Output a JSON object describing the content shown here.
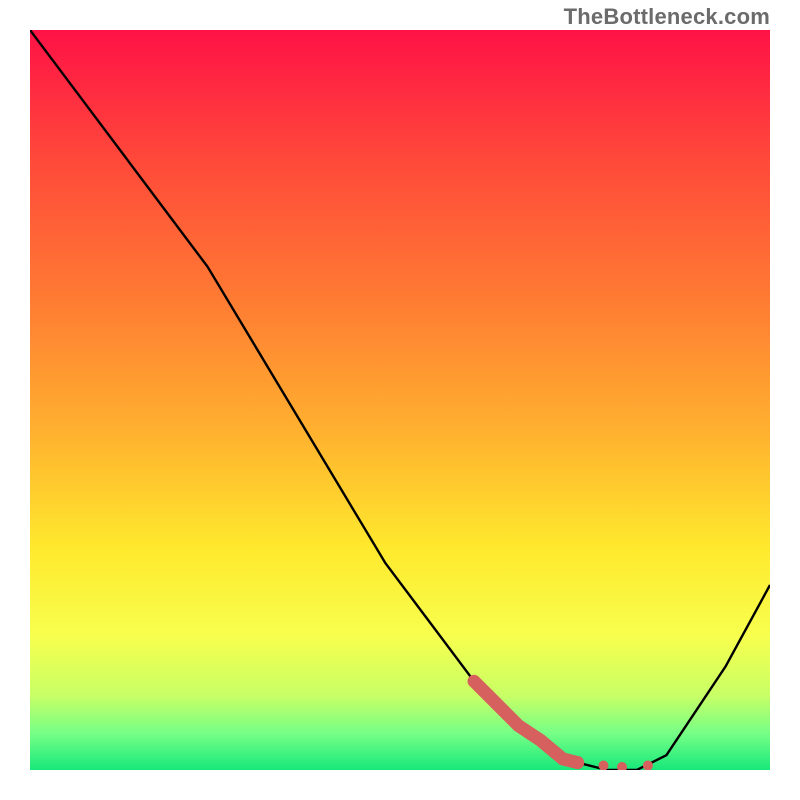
{
  "watermark": "TheBottleneck.com",
  "chart_data": {
    "type": "line",
    "title": "",
    "xlabel": "",
    "ylabel": "",
    "xlim": [
      0,
      100
    ],
    "ylim": [
      0,
      100
    ],
    "curve": {
      "x": [
        0,
        6,
        12,
        18,
        24,
        30,
        36,
        42,
        48,
        54,
        60,
        66,
        70,
        74,
        78,
        82,
        86,
        90,
        94,
        100
      ],
      "y": [
        100,
        92,
        84,
        76,
        68,
        58,
        48,
        38,
        28,
        20,
        12,
        6,
        3,
        1,
        0,
        0,
        2,
        8,
        14,
        25
      ]
    },
    "highlight_segment": {
      "x": [
        60,
        63,
        66,
        69,
        72,
        74
      ],
      "y": [
        12,
        9,
        6,
        4,
        1.5,
        1
      ]
    },
    "highlight_dots": {
      "x": [
        74,
        77.5,
        80,
        83.5
      ],
      "y": [
        1,
        0.6,
        0.4,
        0.6
      ]
    },
    "gradient_stops": [
      {
        "offset": 0.0,
        "color": "#ff1246"
      },
      {
        "offset": 0.18,
        "color": "#ff4a3a"
      },
      {
        "offset": 0.36,
        "color": "#ff7a33"
      },
      {
        "offset": 0.54,
        "color": "#ffb02f"
      },
      {
        "offset": 0.7,
        "color": "#ffe92d"
      },
      {
        "offset": 0.82,
        "color": "#f7ff4e"
      },
      {
        "offset": 0.9,
        "color": "#c7ff66"
      },
      {
        "offset": 0.95,
        "color": "#77ff86"
      },
      {
        "offset": 1.0,
        "color": "#17e87a"
      }
    ],
    "curve_color": "#000000",
    "highlight_color": "#d6605e"
  }
}
